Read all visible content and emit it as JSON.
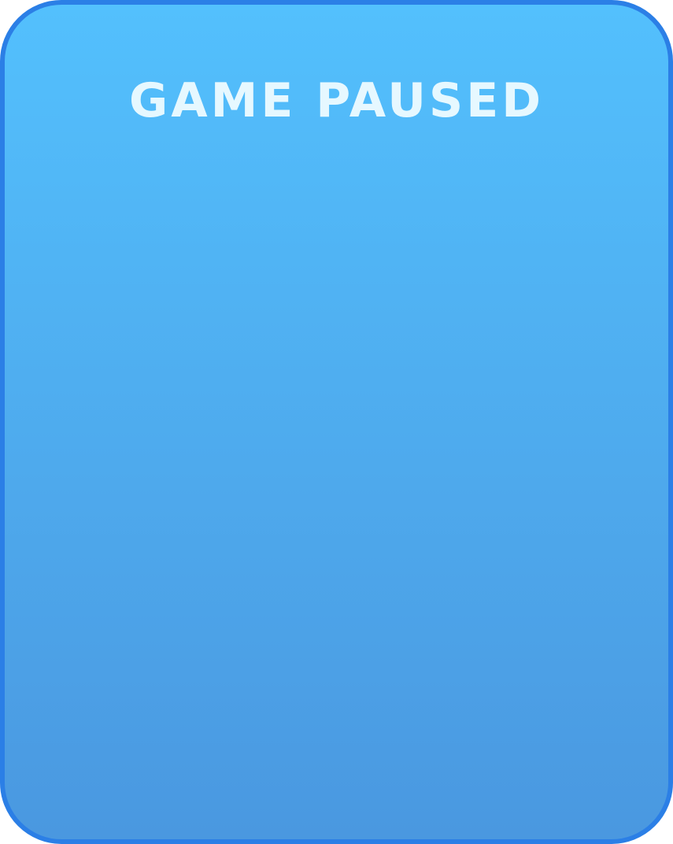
{
  "pause_panel": {
    "title": "GAME PAUSED"
  },
  "colors": {
    "panel_top": "#53c0fd",
    "panel_bottom": "#4a98e0",
    "border": "#2b7fe6",
    "title_text": "#e6f8ff"
  }
}
